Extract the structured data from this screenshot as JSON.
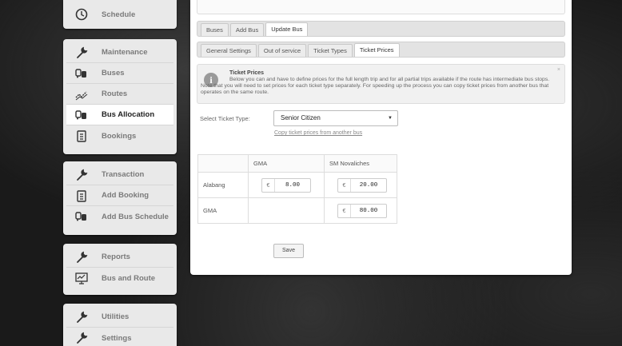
{
  "sidebar": {
    "group1": [
      {
        "label": "Schedule",
        "icon": "clock-icon"
      }
    ],
    "group2": [
      {
        "label": "Maintenance",
        "icon": "wrench-icon"
      },
      {
        "label": "Buses",
        "icon": "bus-icon"
      },
      {
        "label": "Routes",
        "icon": "route-icon"
      },
      {
        "label": "Bus Allocation",
        "icon": "bus-icon",
        "active": true
      },
      {
        "label": "Bookings",
        "icon": "clipboard-icon"
      }
    ],
    "group3": [
      {
        "label": "Transaction",
        "icon": "wrench-icon"
      },
      {
        "label": "Add Booking",
        "icon": "clipboard-icon"
      },
      {
        "label": "Add Bus Schedule",
        "icon": "bus-icon"
      }
    ],
    "group4": [
      {
        "label": "Reports",
        "icon": "wrench-icon"
      },
      {
        "label": "Bus and Route",
        "icon": "presentation-icon"
      }
    ],
    "group5": [
      {
        "label": "Utilities",
        "icon": "wrench-icon"
      },
      {
        "label": "Settings",
        "icon": "wrench-icon"
      }
    ]
  },
  "tabs_primary": [
    "Buses",
    "Add Bus",
    "Update Bus"
  ],
  "tabs_primary_active": "Update Bus",
  "tabs_secondary": [
    "General Settings",
    "Out of service",
    "Ticket Types",
    "Ticket Prices"
  ],
  "tabs_secondary_active": "Ticket Prices",
  "info": {
    "title": "Ticket Prices",
    "body": "Below you can and have to define prices for the full length trip and for all partial trips available if the route has intermediate bus stops. Note that you will need to set prices for each ticket type separately. For speeding up the process you can copy ticket prices from another bus that operates on the same route.",
    "close": "×"
  },
  "ticket_type": {
    "label": "Select Ticket Type:",
    "selected": "Senior Citizen",
    "copy_link": "Copy ticket prices from another bus"
  },
  "prices_table": {
    "columns": [
      "",
      "GMA",
      "SM Novaliches"
    ],
    "rows": [
      {
        "from": "Alabang",
        "gma": "8.00",
        "sm": "20.00"
      },
      {
        "from": "GMA",
        "gma": "",
        "sm": "80.00"
      }
    ],
    "currency": "€"
  },
  "save_label": "Save"
}
